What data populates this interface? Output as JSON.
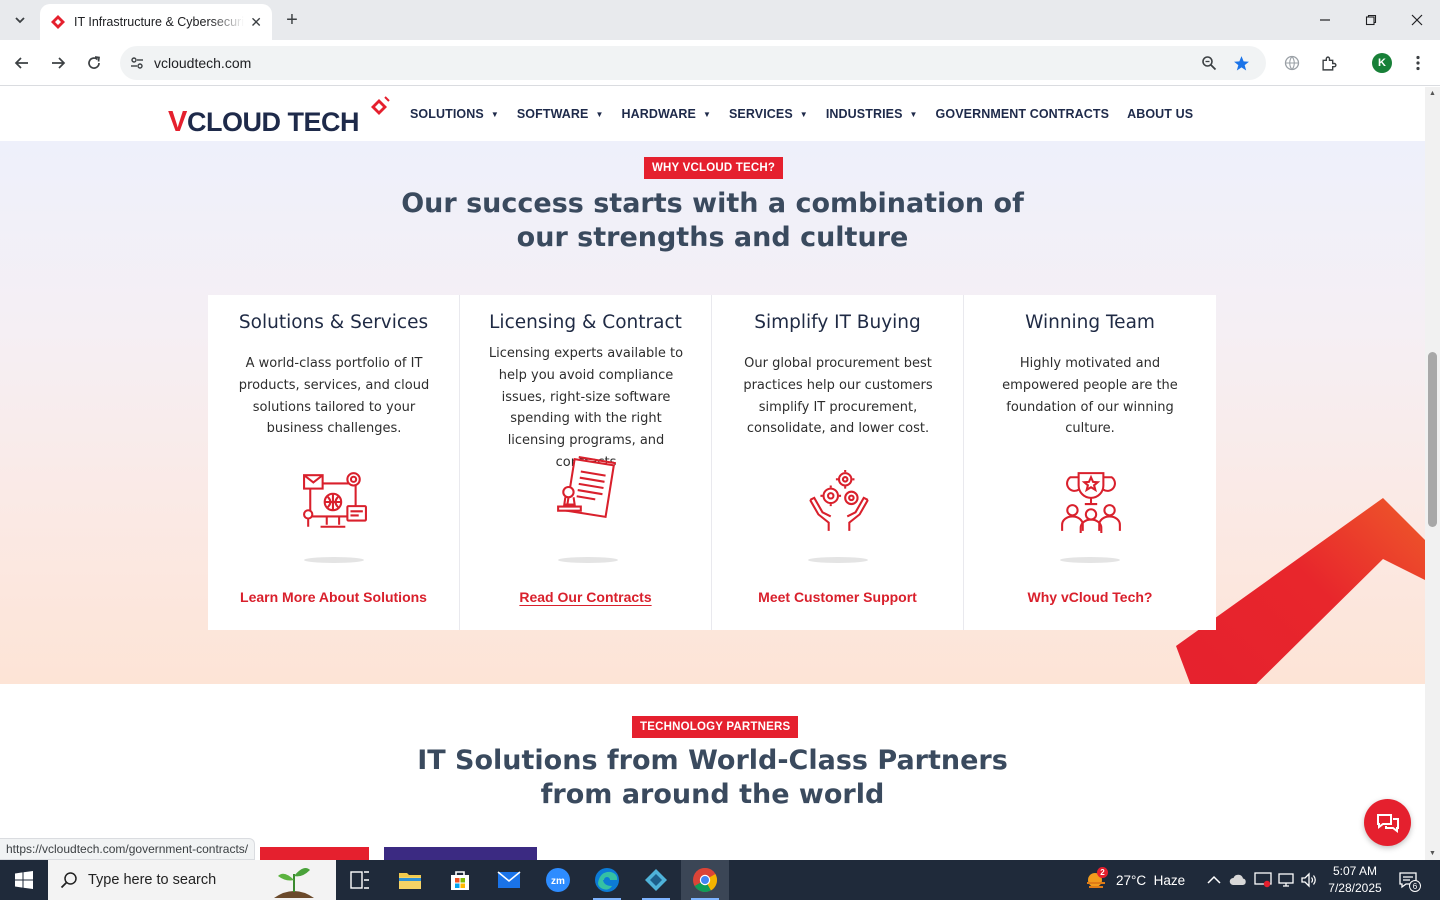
{
  "browser": {
    "tab_title": "IT Infrastructure & Cybersecurity",
    "url": "vcloudtech.com",
    "profile_initial": "K",
    "status_url": "https://vcloudtech.com/government-contracts/"
  },
  "site": {
    "logo_text_v": "V",
    "logo_text": "CLOUD TECH",
    "nav": [
      "SOLUTIONS",
      "SOFTWARE",
      "HARDWARE",
      "SERVICES",
      "INDUSTRIES",
      "GOVERNMENT CONTRACTS",
      "ABOUT US"
    ]
  },
  "strengths": {
    "badge": "WHY VCLOUD TECH?",
    "heading_line1": "Our success starts with a combination of",
    "heading_line2": "our strengths and culture",
    "cards": [
      {
        "title": "Solutions & Services",
        "desc": "A world-class portfolio of IT products, services, and cloud solutions tailored to your business challenges.",
        "link": "Learn More About Solutions",
        "icon": "monitor-gear-icon"
      },
      {
        "title": "Licensing & Contract",
        "desc": "Licensing experts available to help you avoid compliance issues, right-size software spending with the right licensing programs, and contracts",
        "link": "Read Our Contracts",
        "icon": "contract-stamp-icon"
      },
      {
        "title": "Simplify IT Buying",
        "desc": "Our global procurement best practices help our customers simplify IT procurement, consolidate, and lower cost.",
        "link": "Meet Customer Support",
        "icon": "hands-gears-icon"
      },
      {
        "title": "Winning Team",
        "desc": "Highly motivated and empowered people are the foundation of our winning culture.",
        "link": "Why vCloud Tech?",
        "icon": "trophy-team-icon"
      }
    ]
  },
  "partners": {
    "badge": "TECHNOLOGY PARTNERS",
    "heading_line1": "IT Solutions from World-Class Partners",
    "heading_line2": "from around the world"
  },
  "taskbar": {
    "search_placeholder": "Type here to search",
    "weather_badge": "2",
    "weather": "27°C  Haze",
    "time": "5:07 AM",
    "date": "7/28/2025",
    "notifications": "6"
  },
  "colors": {
    "brand_red": "#e5202e",
    "navy": "#1e2a4a",
    "heading": "#3a4a5e"
  }
}
